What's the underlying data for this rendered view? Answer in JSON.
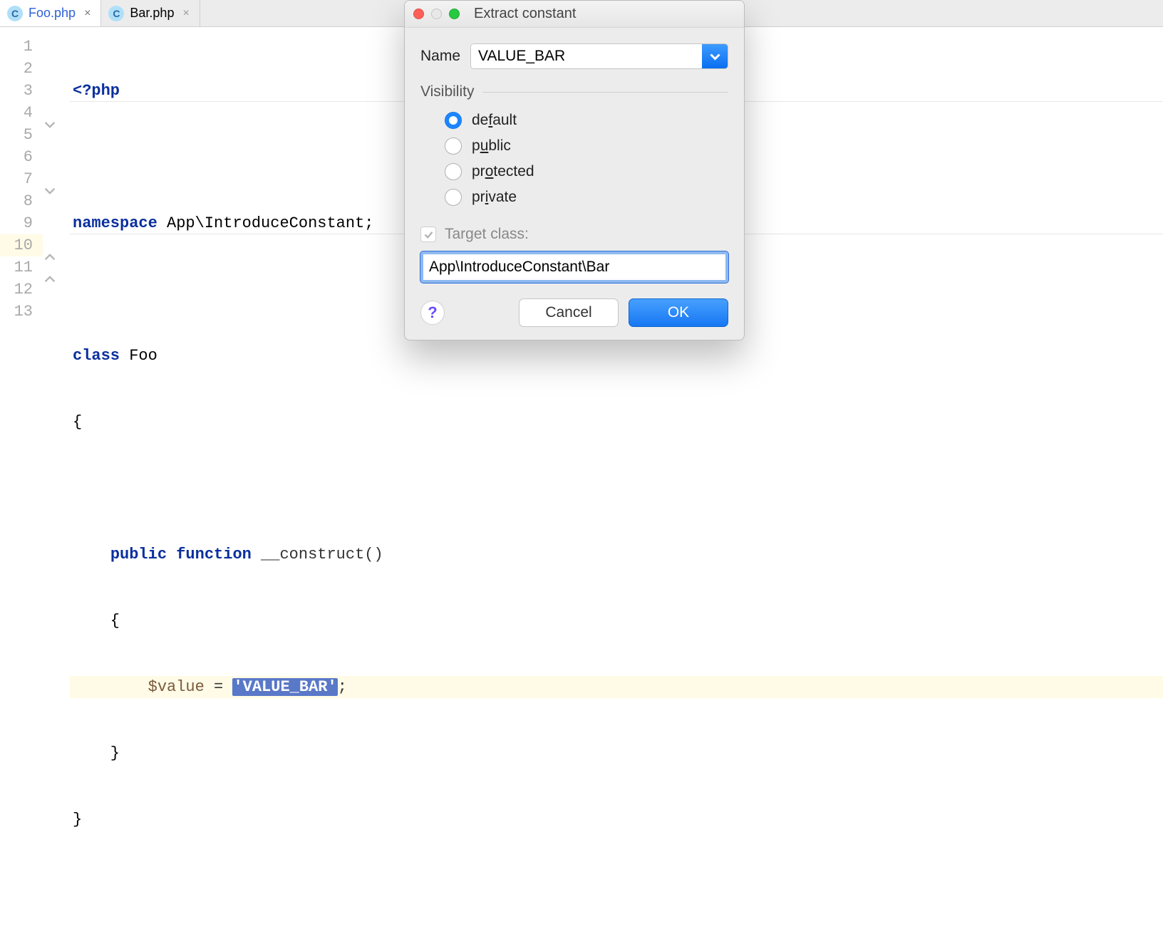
{
  "tabs": [
    {
      "filename": "Foo.php",
      "icon_letter": "C",
      "active": true
    },
    {
      "filename": "Bar.php",
      "icon_letter": "C",
      "active": false
    }
  ],
  "editor": {
    "gutter_numbers": [
      "1",
      "2",
      "3",
      "4",
      "5",
      "6",
      "7",
      "8",
      "9",
      "10",
      "11",
      "12",
      "13"
    ],
    "highlighted_line": 10,
    "lines": {
      "l1_open": "<?php",
      "l3_kw": "namespace",
      "l3_rest": " App\\IntroduceConstant;",
      "l5_kw": "class",
      "l5_name": " Foo",
      "l6": "{",
      "l8_kw1": "public",
      "l8_kw2": "function",
      "l8_name": " __construct()",
      "l9": "    {",
      "l10_var": "$value",
      "l10_eq": " = ",
      "l10_str": "'VALUE_BAR'",
      "l10_semi": ";",
      "l11": "    }",
      "l12": "}"
    }
  },
  "dialog": {
    "title": "Extract constant",
    "name_label": "Name",
    "name_value": "VALUE_BAR",
    "visibility_label": "Visibility",
    "visibility_options": [
      {
        "label_pre": "de",
        "label_u": "f",
        "label_post": "ault",
        "checked": true
      },
      {
        "label_pre": "p",
        "label_u": "u",
        "label_post": "blic",
        "checked": false
      },
      {
        "label_pre": "pr",
        "label_u": "o",
        "label_post": "tected",
        "checked": false
      },
      {
        "label_pre": "pr",
        "label_u": "i",
        "label_post": "vate",
        "checked": false
      }
    ],
    "target_checked": true,
    "target_label": "Target class:",
    "target_value": "App\\IntroduceConstant\\Bar",
    "help": "?",
    "cancel": "Cancel",
    "ok": "OK"
  }
}
